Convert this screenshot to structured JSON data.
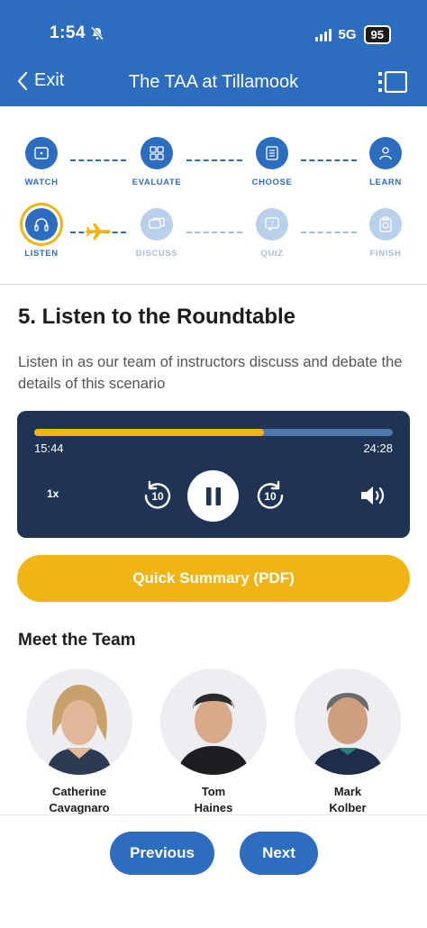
{
  "status_bar": {
    "time": "1:54",
    "network": "5G",
    "battery": "95"
  },
  "nav": {
    "back_label": "Exit",
    "title": "The TAA at Tillamook"
  },
  "steps": [
    {
      "label": "WATCH",
      "state": "done",
      "icon": "video-icon"
    },
    {
      "label": "EVALUATE",
      "state": "done",
      "icon": "grid-icon"
    },
    {
      "label": "CHOOSE",
      "state": "done",
      "icon": "document-icon"
    },
    {
      "label": "LEARN",
      "state": "done",
      "icon": "person-icon"
    },
    {
      "label": "LISTEN",
      "state": "current",
      "icon": "headphones-icon"
    },
    {
      "label": "DISCUSS",
      "state": "pending",
      "icon": "chat-icon"
    },
    {
      "label": "QUIZ",
      "state": "pending",
      "icon": "question-icon"
    },
    {
      "label": "FINISH",
      "state": "pending",
      "icon": "badge-icon"
    }
  ],
  "section": {
    "title": "5. Listen to the Roundtable",
    "description": "Listen in as our team of instructors discuss and debate the details of this scenario"
  },
  "player": {
    "elapsed": "15:44",
    "total": "24:28",
    "progress": 0.64,
    "speed": "1x",
    "skip_back": "10",
    "skip_forward": "10"
  },
  "summary_button": "Quick Summary (PDF)",
  "team": {
    "title": "Meet the Team",
    "members": [
      {
        "first": "Catherine",
        "last": "Cavagnaro"
      },
      {
        "first": "Tom",
        "last": "Haines"
      },
      {
        "first": "Mark",
        "last": "Kolber"
      }
    ]
  },
  "footer": {
    "previous": "Previous",
    "next": "Next"
  },
  "colors": {
    "primary": "#2d6dbf",
    "accent": "#f0b514",
    "player_bg": "#1f3354"
  }
}
